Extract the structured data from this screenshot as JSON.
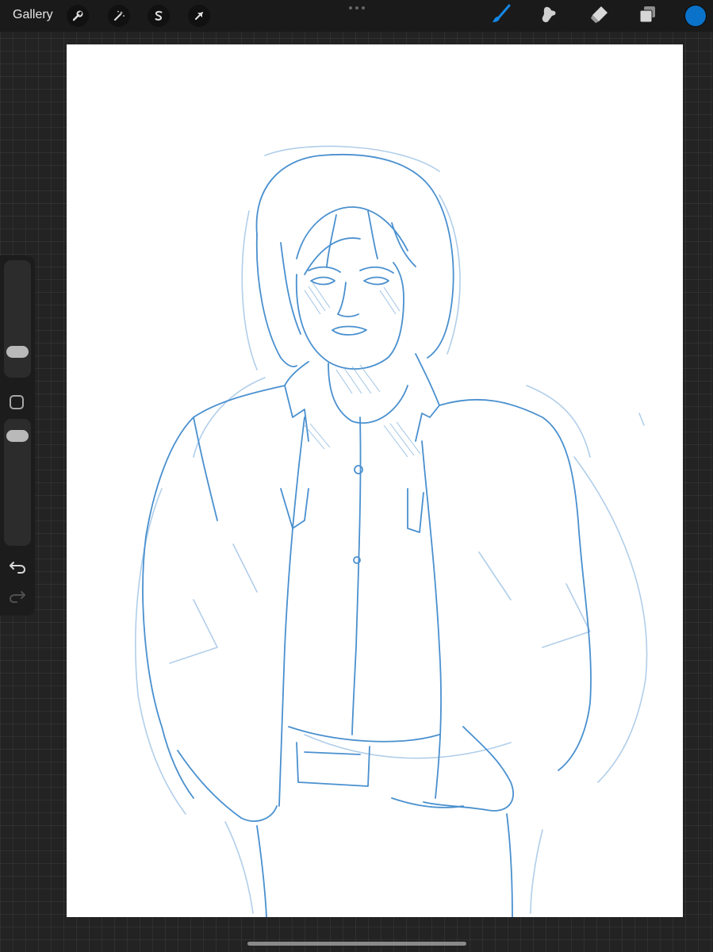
{
  "topbar": {
    "gallery_label": "Gallery",
    "left_tools": [
      "wrench-icon",
      "magic-wand-icon",
      "selection-s-icon",
      "transform-arrow-icon"
    ],
    "right_tools": [
      "brush-icon",
      "smudge-icon",
      "eraser-icon",
      "layers-icon"
    ],
    "active_tool": "brush-icon",
    "active_color": "#0a72c8"
  },
  "sidebar": {
    "brush_size_slider": "brush-size",
    "brush_opacity_slider": "brush-opacity",
    "modifier_button": "square-modifier-icon",
    "undo": "undo-icon",
    "redo": "redo-icon"
  },
  "canvas": {
    "background": "#ffffff",
    "stroke_color": "#3f86c8",
    "light_stroke_color": "#a9c9e8"
  }
}
